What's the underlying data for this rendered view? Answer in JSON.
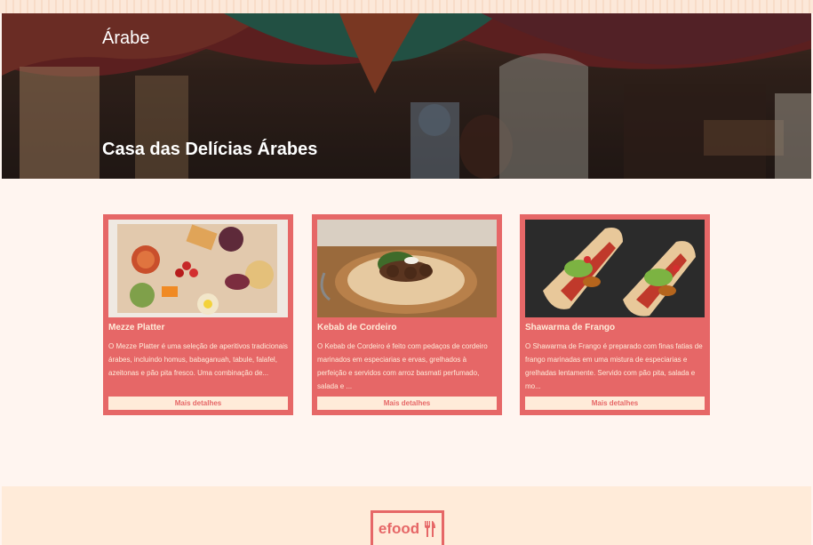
{
  "hero": {
    "category": "Árabe",
    "restaurant_name": "Casa das Delícias Árabes"
  },
  "dishes": [
    {
      "name": "Mezze Platter",
      "description": "O Mezze Platter é uma seleção de aperitivos tradicionais árabes, incluindo homus, babaganuah, tabule, falafel, azeitonas e pão pita fresco. Uma combinação de...",
      "button": "Mais detalhes"
    },
    {
      "name": "Kebab de Cordeiro",
      "description": "O Kebab de Cordeiro é feito com pedaços de cordeiro marinados em especiarias e ervas, grelhados à perfeição e servidos com arroz basmati perfumado, salada e ...",
      "button": "Mais detalhes"
    },
    {
      "name": "Shawarma de Frango",
      "description": "O Shawarma de Frango é preparado com finas fatias de frango marinadas em uma mistura de especiarias e grelhadas lentamente. Servido com pão pita, salada e mo...",
      "button": "Mais detalhes"
    }
  ],
  "footer": {
    "logo_text": "efood",
    "logo_icon": "fork-knife-icon"
  },
  "colors": {
    "accent": "#E66767",
    "cream": "#FFEBD9",
    "page_bg": "#FFF5F0"
  }
}
